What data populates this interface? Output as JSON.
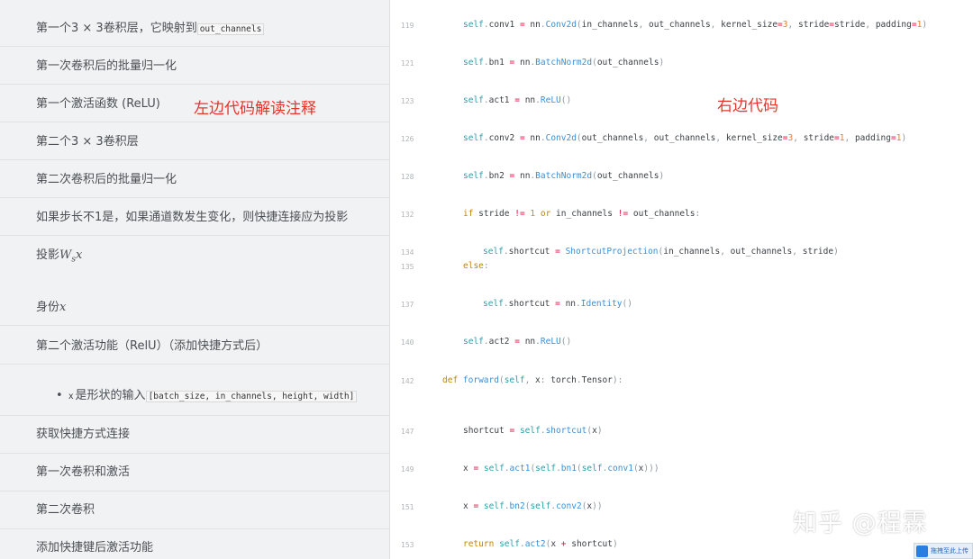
{
  "left_items": [
    {
      "text": "第一个3 × 3卷积层，它映射到",
      "code": "out_channels"
    },
    {
      "text": "第一次卷积后的批量归一化"
    },
    {
      "text": "第一个激活函数 (ReLU)"
    },
    {
      "text": "第二个3 × 3卷积层"
    },
    {
      "text": "第二次卷积后的批量归一化"
    },
    {
      "text": "如果步长不1是，如果通道数发生变化，则快捷连接应为投影"
    },
    {
      "text": "投影",
      "math": "W",
      "sub": "s",
      "math2": "x"
    },
    {
      "text": "身份",
      "math": "x"
    },
    {
      "text": "第二个激活功能（RelU）（添加快捷方式后）"
    },
    {
      "bullet": "•",
      "code1": "x",
      "text": "是形状的输入",
      "code": "[batch_size, in_channels, height, width]"
    },
    {
      "text": "获取快捷方式连接"
    },
    {
      "text": "第一次卷积和激活"
    },
    {
      "text": "第二次卷积"
    },
    {
      "text": "添加快捷键后激活功能"
    }
  ],
  "annotations": {
    "left": "左边代码解读注释",
    "right": "右边代码"
  },
  "code_lines": [
    {
      "num": "119",
      "code": "self.conv1 = nn.Conv2d(in_channels, out_channels, kernel_size=3, stride=stride, padding=1)"
    },
    {
      "num": "121",
      "code": "self.bn1 = nn.BatchNorm2d(out_channels)"
    },
    {
      "num": "123",
      "code": "self.act1 = nn.ReLU()"
    },
    {
      "num": "126",
      "code": "self.conv2 = nn.Conv2d(out_channels, out_channels, kernel_size=3, stride=1, padding=1)"
    },
    {
      "num": "128",
      "code": "self.bn2 = nn.BatchNorm2d(out_channels)"
    },
    {
      "num": "132",
      "code": "if stride != 1 or in_channels != out_channels:"
    },
    {
      "num": "134",
      "code": "self.shortcut = ShortcutProjection(in_channels, out_channels, stride)"
    },
    {
      "num": "135",
      "code": "else:"
    },
    {
      "num": "137",
      "code": "self.shortcut = nn.Identity()"
    },
    {
      "num": "140",
      "code": "self.act2 = nn.ReLU()"
    },
    {
      "num": "142",
      "code": "def forward(self, x: torch.Tensor):"
    },
    {
      "num": "147",
      "code": "shortcut = self.shortcut(x)"
    },
    {
      "num": "149",
      "code": "x = self.act1(self.bn1(self.conv1(x)))"
    },
    {
      "num": "151",
      "code": "x = self.bn2(self.conv2(x))"
    },
    {
      "num": "153",
      "code": "return self.act2(x + shortcut)"
    }
  ],
  "watermark": "知乎 @程霖",
  "badge": "拖拽至此上传"
}
